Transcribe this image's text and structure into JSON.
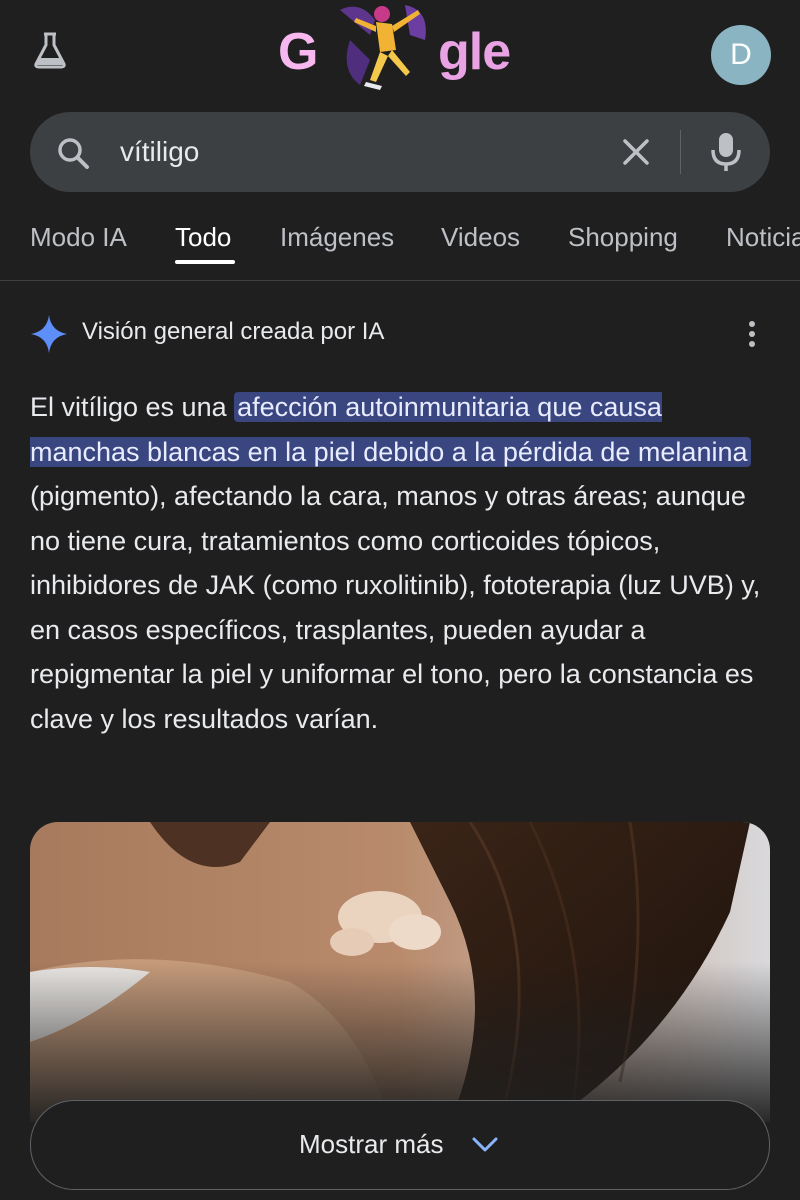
{
  "header": {
    "logo_left": "G",
    "logo_right": "gle",
    "labs_icon": "flask-icon",
    "avatar_initial": "D"
  },
  "search": {
    "query": "vítiligo",
    "icons": [
      "search-icon",
      "close-icon",
      "mic-icon"
    ]
  },
  "tabs": [
    {
      "label": "Modo IA"
    },
    {
      "label": "Todo",
      "active": true
    },
    {
      "label": "Imágenes"
    },
    {
      "label": "Videos"
    },
    {
      "label": "Shopping"
    },
    {
      "label": "Noticias"
    }
  ],
  "ai_overview": {
    "title": "Visión general creada por IA",
    "body_intro": "El vitíligo es una",
    "body_highlight": "afección autoinmunitaria que causa manchas blancas en la piel debido a la pérdida de melanina",
    "body_rest": "(pigmento), afectando la cara, manos y otras áreas; aunque no tiene cura, tratamientos como corticoides tópicos, inhibidores de JAK (como ruxolitinib), fototerapia (luz UVB) y, en casos específicos, trasplantes, pueden ayudar a repigmentar la piel y uniformar el tono, pero la constancia es clave y los resultados varían.",
    "show_more_label": "Mostrar más"
  },
  "colors": {
    "background": "#1f1f1f",
    "search_bar": "#3c4043",
    "highlight": "#394680",
    "avatar": "#8ab4c2",
    "sparkle": "#5e8ef7"
  }
}
